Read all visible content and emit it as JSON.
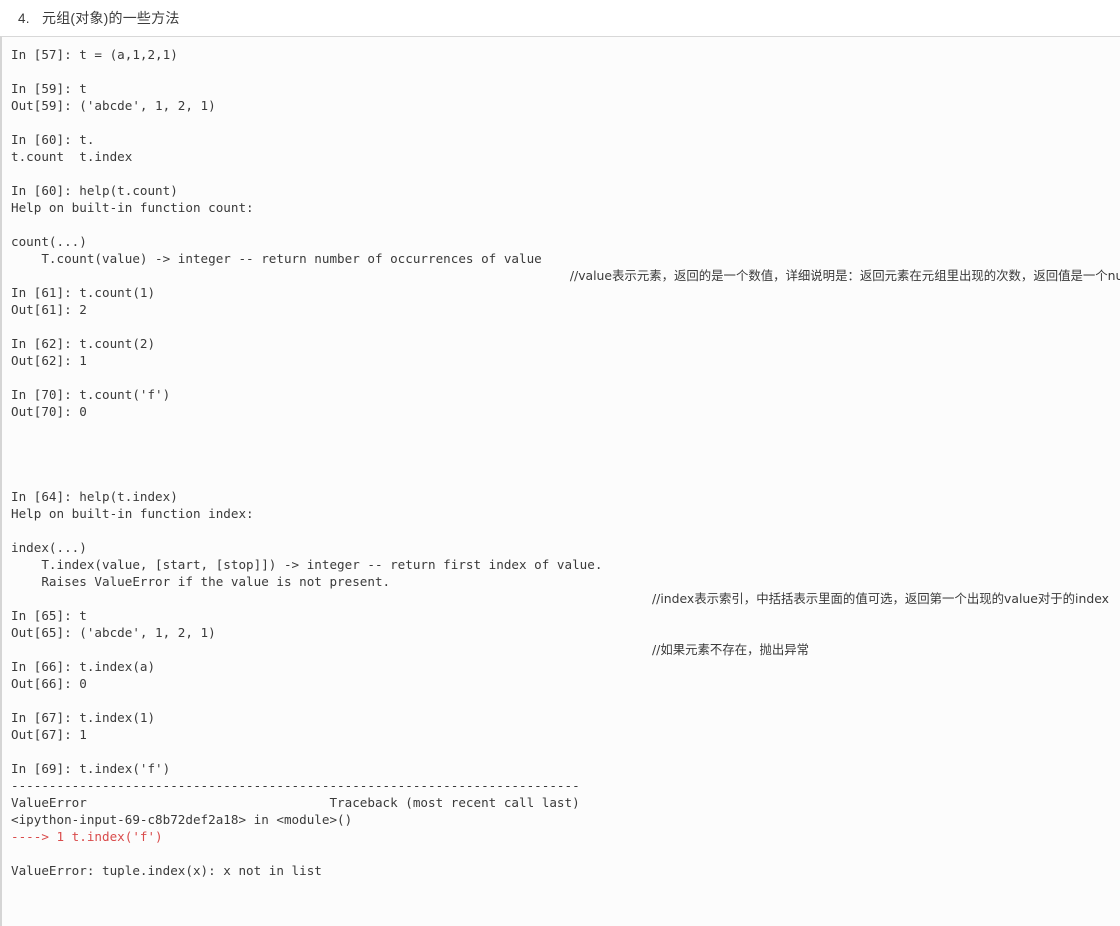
{
  "heading": {
    "number": "4.",
    "text": "元组(对象)的一些方法"
  },
  "notebook": {
    "lines": [
      "In [57]: t = (a,1,2,1)",
      "",
      "In [59]: t",
      "Out[59]: ('abcde', 1, 2, 1)",
      "",
      "In [60]: t.",
      "t.count  t.index",
      "",
      "In [60]: help(t.count)",
      "Help on built-in function count:",
      "",
      "count(...)",
      "    T.count(value) -> integer -- return number of occurrences of value",
      "",
      "In [61]: t.count(1)",
      "Out[61]: 2",
      "",
      "In [62]: t.count(2)",
      "Out[62]: 1",
      "",
      "In [70]: t.count('f')",
      "Out[70]: 0",
      "",
      "",
      "",
      "",
      "In [64]: help(t.index)",
      "Help on built-in function index:",
      "",
      "index(...)",
      "    T.index(value, [start, [stop]]) -> integer -- return first index of value.",
      "    Raises ValueError if the value is not present.",
      "",
      "In [65]: t",
      "Out[65]: ('abcde', 1, 2, 1)",
      "",
      "In [66]: t.index(a)",
      "Out[66]: 0",
      "",
      "In [67]: t.index(1)",
      "Out[67]: 1",
      "",
      "In [69]: t.index('f')",
      "---------------------------------------------------------------------------",
      "ValueError                                Traceback (most recent call last)",
      "<ipython-input-69-c8b72def2a18> in <module>()",
      "----> 1 t.index('f')",
      "",
      "ValueError: tuple.index(x): x not in list"
    ],
    "error_line_indices": [
      46
    ],
    "error_color": "#d94b4b"
  },
  "annotations": {
    "count_comment": "//value表示元素，返回的是一个数值，详细说明是：返回元素在元组里出现的次数，返回值是一个number",
    "index_comment_1": "//index表示索引，中括括表示里面的值可选，返回第一个出现的value对于的index",
    "index_comment_2": "//如果元素不存在，抛出异常"
  }
}
